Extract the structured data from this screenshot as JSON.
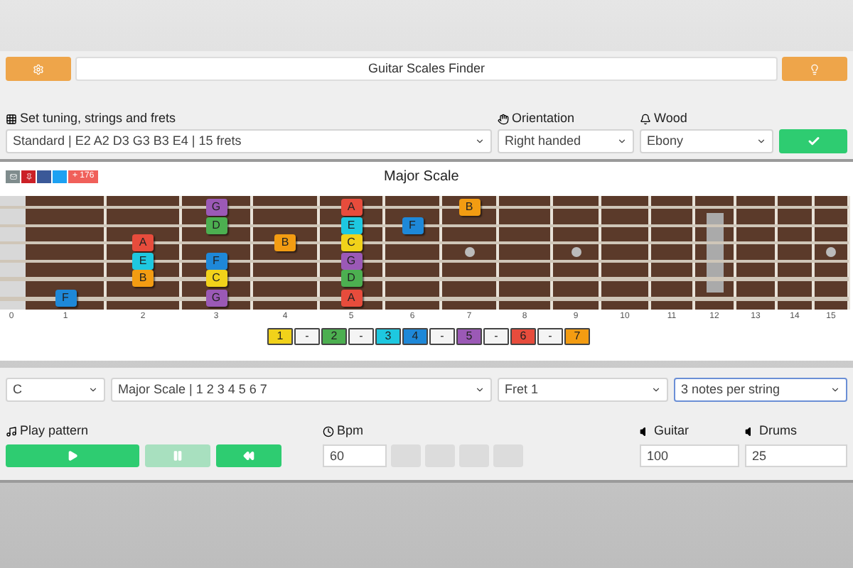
{
  "header": {
    "title": "Guitar Scales Finder"
  },
  "settings": {
    "tuning": {
      "label": "Set tuning, strings and frets",
      "value": "Standard | E2 A2 D3 G3 B3 E4 | 15 frets"
    },
    "orientation": {
      "label": "Orientation",
      "value": "Right handed"
    },
    "wood": {
      "label": "Wood",
      "value": "Ebony"
    }
  },
  "share": {
    "count": "+ 176"
  },
  "fretboard": {
    "title": "Major Scale",
    "fret_numbers": [
      "0",
      "1",
      "2",
      "3",
      "4",
      "5",
      "6",
      "7",
      "8",
      "9",
      "10",
      "11",
      "12",
      "13",
      "14",
      "15"
    ],
    "strings": [
      {
        "frets": [
          {
            "kind": "empty"
          },
          {
            "kind": "empty"
          },
          {
            "kind": "empty"
          },
          {
            "kind": "note",
            "note": "G",
            "color": "#9b59b6"
          },
          {
            "kind": "empty"
          },
          {
            "kind": "note",
            "note": "A",
            "color": "#e74c3c"
          },
          {
            "kind": "empty"
          },
          {
            "kind": "note",
            "note": "B",
            "color": "#f39c12"
          },
          {
            "kind": "empty"
          },
          {
            "kind": "empty"
          },
          {
            "kind": "empty"
          },
          {
            "kind": "empty"
          },
          {
            "kind": "empty"
          },
          {
            "kind": "empty"
          },
          {
            "kind": "empty"
          },
          {
            "kind": "empty"
          }
        ]
      },
      {
        "frets": [
          {
            "kind": "empty"
          },
          {
            "kind": "empty"
          },
          {
            "kind": "empty"
          },
          {
            "kind": "note",
            "note": "D",
            "color": "#4caf50"
          },
          {
            "kind": "empty"
          },
          {
            "kind": "note",
            "note": "E",
            "color": "#1ec8e0"
          },
          {
            "kind": "note",
            "note": "F",
            "color": "#1e88d8"
          },
          {
            "kind": "empty"
          },
          {
            "kind": "empty"
          },
          {
            "kind": "empty"
          },
          {
            "kind": "empty"
          },
          {
            "kind": "empty"
          },
          {
            "kind": "empty"
          },
          {
            "kind": "empty"
          },
          {
            "kind": "empty"
          },
          {
            "kind": "empty"
          }
        ]
      },
      {
        "frets": [
          {
            "kind": "empty"
          },
          {
            "kind": "empty"
          },
          {
            "kind": "note",
            "note": "A",
            "color": "#e74c3c"
          },
          {
            "kind": "empty"
          },
          {
            "kind": "note",
            "note": "B",
            "color": "#f39c12"
          },
          {
            "kind": "note",
            "note": "C",
            "color": "#f1d21a"
          },
          {
            "kind": "empty"
          },
          {
            "kind": "empty"
          },
          {
            "kind": "empty"
          },
          {
            "kind": "empty"
          },
          {
            "kind": "empty"
          },
          {
            "kind": "empty"
          },
          {
            "kind": "empty"
          },
          {
            "kind": "empty"
          },
          {
            "kind": "empty"
          },
          {
            "kind": "empty"
          }
        ]
      },
      {
        "frets": [
          {
            "kind": "empty"
          },
          {
            "kind": "empty"
          },
          {
            "kind": "note",
            "note": "E",
            "color": "#1ec8e0"
          },
          {
            "kind": "note",
            "note": "F",
            "color": "#1e88d8"
          },
          {
            "kind": "empty"
          },
          {
            "kind": "note",
            "note": "G",
            "color": "#9b59b6"
          },
          {
            "kind": "empty"
          },
          {
            "kind": "empty"
          },
          {
            "kind": "empty"
          },
          {
            "kind": "empty"
          },
          {
            "kind": "empty"
          },
          {
            "kind": "empty"
          },
          {
            "kind": "empty"
          },
          {
            "kind": "empty"
          },
          {
            "kind": "empty"
          },
          {
            "kind": "empty"
          }
        ]
      },
      {
        "frets": [
          {
            "kind": "empty"
          },
          {
            "kind": "empty"
          },
          {
            "kind": "note",
            "note": "B",
            "color": "#f39c12"
          },
          {
            "kind": "note",
            "note": "C",
            "color": "#f1d21a"
          },
          {
            "kind": "empty"
          },
          {
            "kind": "note",
            "note": "D",
            "color": "#4caf50"
          },
          {
            "kind": "empty"
          },
          {
            "kind": "empty"
          },
          {
            "kind": "empty"
          },
          {
            "kind": "empty"
          },
          {
            "kind": "empty"
          },
          {
            "kind": "empty"
          },
          {
            "kind": "empty"
          },
          {
            "kind": "empty"
          },
          {
            "kind": "empty"
          },
          {
            "kind": "empty"
          }
        ]
      },
      {
        "frets": [
          {
            "kind": "empty"
          },
          {
            "kind": "note",
            "note": "F",
            "color": "#1e88d8"
          },
          {
            "kind": "empty"
          },
          {
            "kind": "note",
            "note": "G",
            "color": "#9b59b6"
          },
          {
            "kind": "empty"
          },
          {
            "kind": "note",
            "note": "A",
            "color": "#e74c3c"
          },
          {
            "kind": "empty"
          },
          {
            "kind": "empty"
          },
          {
            "kind": "empty"
          },
          {
            "kind": "empty"
          },
          {
            "kind": "empty"
          },
          {
            "kind": "empty"
          },
          {
            "kind": "empty"
          },
          {
            "kind": "empty"
          },
          {
            "kind": "empty"
          },
          {
            "kind": "empty"
          }
        ]
      }
    ]
  },
  "degrees": [
    {
      "label": "1",
      "color": "#f1d21a"
    },
    {
      "label": "-"
    },
    {
      "label": "2",
      "color": "#4caf50"
    },
    {
      "label": "-"
    },
    {
      "label": "3",
      "color": "#1ec8e0"
    },
    {
      "label": "4",
      "color": "#1e88d8"
    },
    {
      "label": "-"
    },
    {
      "label": "5",
      "color": "#9b59b6"
    },
    {
      "label": "-"
    },
    {
      "label": "6",
      "color": "#e74c3c"
    },
    {
      "label": "-"
    },
    {
      "label": "7",
      "color": "#f39c12"
    }
  ],
  "scale_controls": [
    {
      "value": "C",
      "focused": false
    },
    {
      "value": "Major Scale | 1 2 3 4 5 6 7",
      "focused": false
    },
    {
      "value": "Fret 1",
      "focused": false
    },
    {
      "value": "3 notes per string",
      "focused": true
    }
  ],
  "player": {
    "label": "Play pattern",
    "buttons": [
      {
        "kind": "play",
        "disabled": false
      },
      {
        "kind": "pause",
        "disabled": true
      },
      {
        "kind": "rewind",
        "disabled": false
      }
    ],
    "bpm": {
      "label": "Bpm",
      "value": "60"
    },
    "beats": [
      {
        "on": false
      },
      {
        "on": false
      },
      {
        "on": false
      },
      {
        "on": false
      }
    ],
    "guitar": {
      "label": "Guitar",
      "value": "100"
    },
    "drums": {
      "label": "Drums",
      "value": "25"
    }
  }
}
